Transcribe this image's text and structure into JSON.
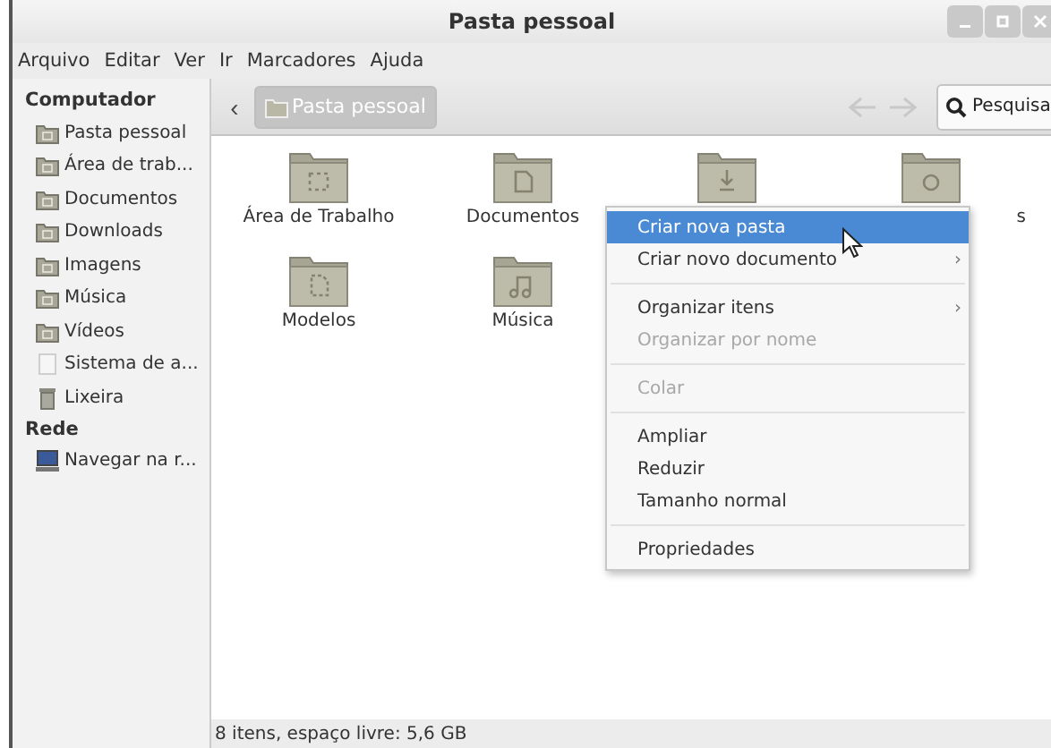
{
  "window": {
    "title": "Pasta pessoal"
  },
  "menu_bar": [
    "Arquivo",
    "Editar",
    "Ver",
    "Ir",
    "Marcadores",
    "Ajuda"
  ],
  "sidebar": [
    {
      "title": "Computador",
      "items": [
        {
          "label": "Pasta pessoal",
          "kind": "home"
        },
        {
          "label": "Área de trab...",
          "kind": "desktop"
        },
        {
          "label": "Documentos",
          "kind": "documents"
        },
        {
          "label": "Downloads",
          "kind": "downloads"
        },
        {
          "label": "Imagens",
          "kind": "pictures"
        },
        {
          "label": "Música",
          "kind": "music"
        },
        {
          "label": "Vídeos",
          "kind": "videos"
        },
        {
          "label": "Sistema de a...",
          "kind": "drive"
        },
        {
          "label": "Lixeira",
          "kind": "trash"
        }
      ]
    },
    {
      "title": "Rede",
      "items": [
        {
          "label": "Navegar na r...",
          "kind": "network"
        }
      ]
    }
  ],
  "toolbar": {
    "back": "‹",
    "location": "Pasta pessoal",
    "search": "Pesquisa"
  },
  "files": [
    {
      "label": "Área de Trabalho",
      "kind": "desktop"
    },
    {
      "label": "Documentos",
      "kind": "documents"
    },
    {
      "kind": "downloads"
    },
    {
      "label": "s",
      "kind": "pictures",
      "clipped": true
    },
    {
      "label": "Modelos",
      "kind": "templates"
    },
    {
      "label": "Música",
      "kind": "music"
    }
  ],
  "context_menu": [
    {
      "kind": "item",
      "label": "Criar nova pasta",
      "highlighted": true,
      "disabled": false,
      "submenu": false
    },
    {
      "kind": "item",
      "label": "Criar novo documento",
      "highlighted": false,
      "disabled": false,
      "submenu": true
    },
    {
      "kind": "separator"
    },
    {
      "kind": "item",
      "label": "Organizar itens",
      "highlighted": false,
      "disabled": false,
      "submenu": true
    },
    {
      "kind": "item",
      "label": "Organizar por nome",
      "highlighted": false,
      "disabled": true,
      "submenu": false
    },
    {
      "kind": "separator"
    },
    {
      "kind": "item",
      "label": "Colar",
      "highlighted": false,
      "disabled": true,
      "submenu": false
    },
    {
      "kind": "separator"
    },
    {
      "kind": "item",
      "label": "Ampliar",
      "highlighted": false,
      "disabled": false,
      "submenu": false
    },
    {
      "kind": "item",
      "label": "Reduzir",
      "highlighted": false,
      "disabled": false,
      "submenu": false
    },
    {
      "kind": "item",
      "label": "Tamanho normal",
      "highlighted": false,
      "disabled": false,
      "submenu": false
    },
    {
      "kind": "separator"
    },
    {
      "kind": "item",
      "label": "Propriedades",
      "highlighted": false,
      "disabled": false,
      "submenu": false
    }
  ],
  "submenu_glyph": "›",
  "status_bar": "8 itens, espaço livre: 5,6 GB"
}
